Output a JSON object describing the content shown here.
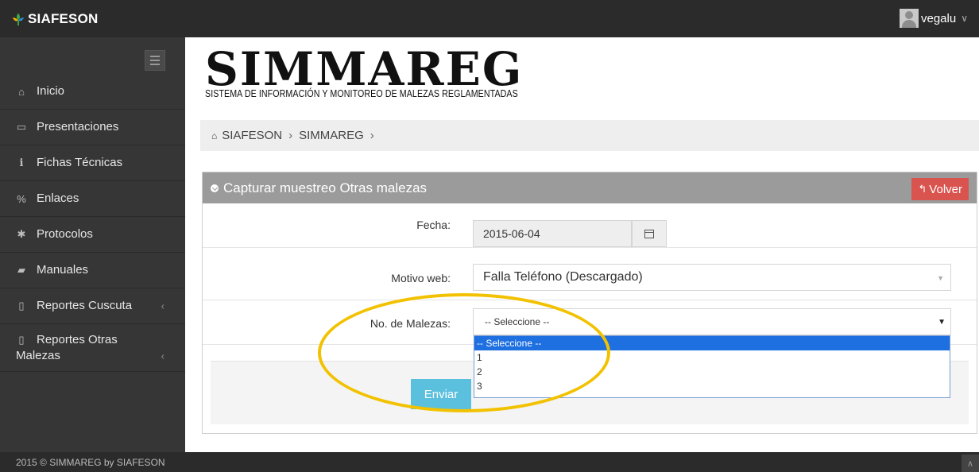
{
  "brand": {
    "name": "SIAFESON"
  },
  "user": {
    "name": "vegalu"
  },
  "sidebar": {
    "items": [
      {
        "icon": "home-icon",
        "glyph": "⌂",
        "label": "Inicio",
        "arrow": ""
      },
      {
        "icon": "folder-icon",
        "glyph": "▭",
        "label": "Presentaciones",
        "arrow": ""
      },
      {
        "icon": "info-icon",
        "glyph": "i",
        "label": "Fichas Técnicas",
        "arrow": ""
      },
      {
        "icon": "link-icon",
        "glyph": "%",
        "label": "Enlaces",
        "arrow": ""
      },
      {
        "icon": "gear-icon",
        "glyph": "✱",
        "label": "Protocolos",
        "arrow": ""
      },
      {
        "icon": "book-icon",
        "glyph": "▰",
        "label": "Manuales",
        "arrow": ""
      },
      {
        "icon": "file-icon",
        "glyph": "▯",
        "label": "Reportes Cuscuta",
        "arrow": "‹"
      },
      {
        "icon": "file-icon",
        "glyph": "▯",
        "label": "Reportes Otras Malezas",
        "arrow": "‹"
      }
    ]
  },
  "header": {
    "logo_title": "SIMMAREG",
    "logo_subtitle": "SISTEMA DE INFORMACIÓN Y MONITOREO DE MALEZAS REGLAMENTADAS"
  },
  "breadcrumb": {
    "items": [
      "SIAFESON",
      "SIMMAREG"
    ],
    "separator": "›"
  },
  "panel": {
    "title": "Capturar muestreo Otras malezas",
    "back_label": "Volver"
  },
  "form": {
    "fecha": {
      "label": "Fecha:",
      "value": "2015-06-04"
    },
    "motivo": {
      "label": "Motivo web:",
      "value": "Falla Teléfono (Descargado)"
    },
    "malezas": {
      "label": "No. de Malezas:",
      "value": "-- Seleccione --",
      "options": [
        "-- Seleccione --",
        "1",
        "2",
        "3"
      ],
      "selected_index": 0
    },
    "submit_label": "Enviar"
  },
  "footer": {
    "text": "2015 © SIMMAREG by SIAFESON"
  },
  "colors": {
    "topbar": "#2b2b2b",
    "sidebar": "#363636",
    "panel_header": "#9b9b9b",
    "back_button": "#d9534f",
    "submit_button": "#5bc0de",
    "highlight": "#f2c200",
    "selected_option": "#1e6fe0"
  }
}
